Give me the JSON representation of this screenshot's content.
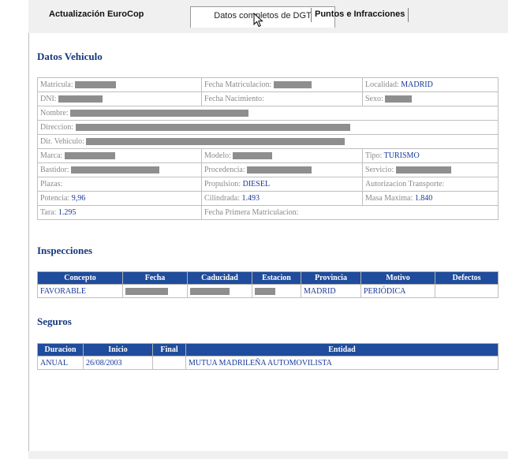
{
  "tabs": {
    "eurocop": "Actualización EuroCop",
    "dgt": "Datos completos de DGT",
    "puntos": "Puntos e Infracciones"
  },
  "vehiculo": {
    "title": "Datos Vehiculo",
    "matricula": "Matricula:",
    "fecha_matriculacion": "Fecha Matriculacion:",
    "localidad_label": "Localidad:",
    "localidad_value": "MADRID",
    "dni": "DNI:",
    "fecha_nacimiento": "Fecha Nacimiento:",
    "sexo": "Sexo:",
    "nombre": "Nombre:",
    "direccion": "Direccion:",
    "dir_vehiculo": "Dir. Vehiculo:",
    "marca": "Marca:",
    "modelo": "Modelo:",
    "tipo_label": "Tipo:",
    "tipo_value": "TURISMO",
    "bastidor": "Bastidor:",
    "procedencia": "Procedencia:",
    "servicio": "Servicio:",
    "plazas": "Plazas:",
    "propulsion_label": "Propulsion:",
    "propulsion_value": "DIESEL",
    "autorizacion": "Autorizacion Transporte:",
    "potencia_label": "Potencia:",
    "potencia_value": "9,96",
    "cilindrada_label": "Cilindrada:",
    "cilindrada_value": "1.493",
    "masa_label": "Masa Maxima:",
    "masa_value": "1.840",
    "tara_label": "Tara:",
    "tara_value": "1.295",
    "fecha_primera": "Fecha Primera Matriculacion:"
  },
  "inspecciones": {
    "title": "Inspecciones",
    "headers": [
      "Concepto",
      "Fecha",
      "Caducidad",
      "Estacion",
      "Provincia",
      "Motivo",
      "Defectos"
    ],
    "row": {
      "concepto": "FAVORABLE",
      "provincia": "MADRID",
      "motivo": "PERIÓDICA"
    }
  },
  "seguros": {
    "title": "Seguros",
    "headers": [
      "Duracion",
      "Inicio",
      "Final",
      "Entidad"
    ],
    "row": {
      "duracion": "ANUAL",
      "inicio": "26/08/2003",
      "final": "",
      "entidad": "MUTUA MADRILEÑA AUTOMOVILISTA"
    }
  },
  "icons": {
    "cursor": "mouse-pointer-icon"
  },
  "colors": {
    "header_bg": "#1f4c9c",
    "value_text": "#16389a",
    "section_title": "#16387d"
  }
}
